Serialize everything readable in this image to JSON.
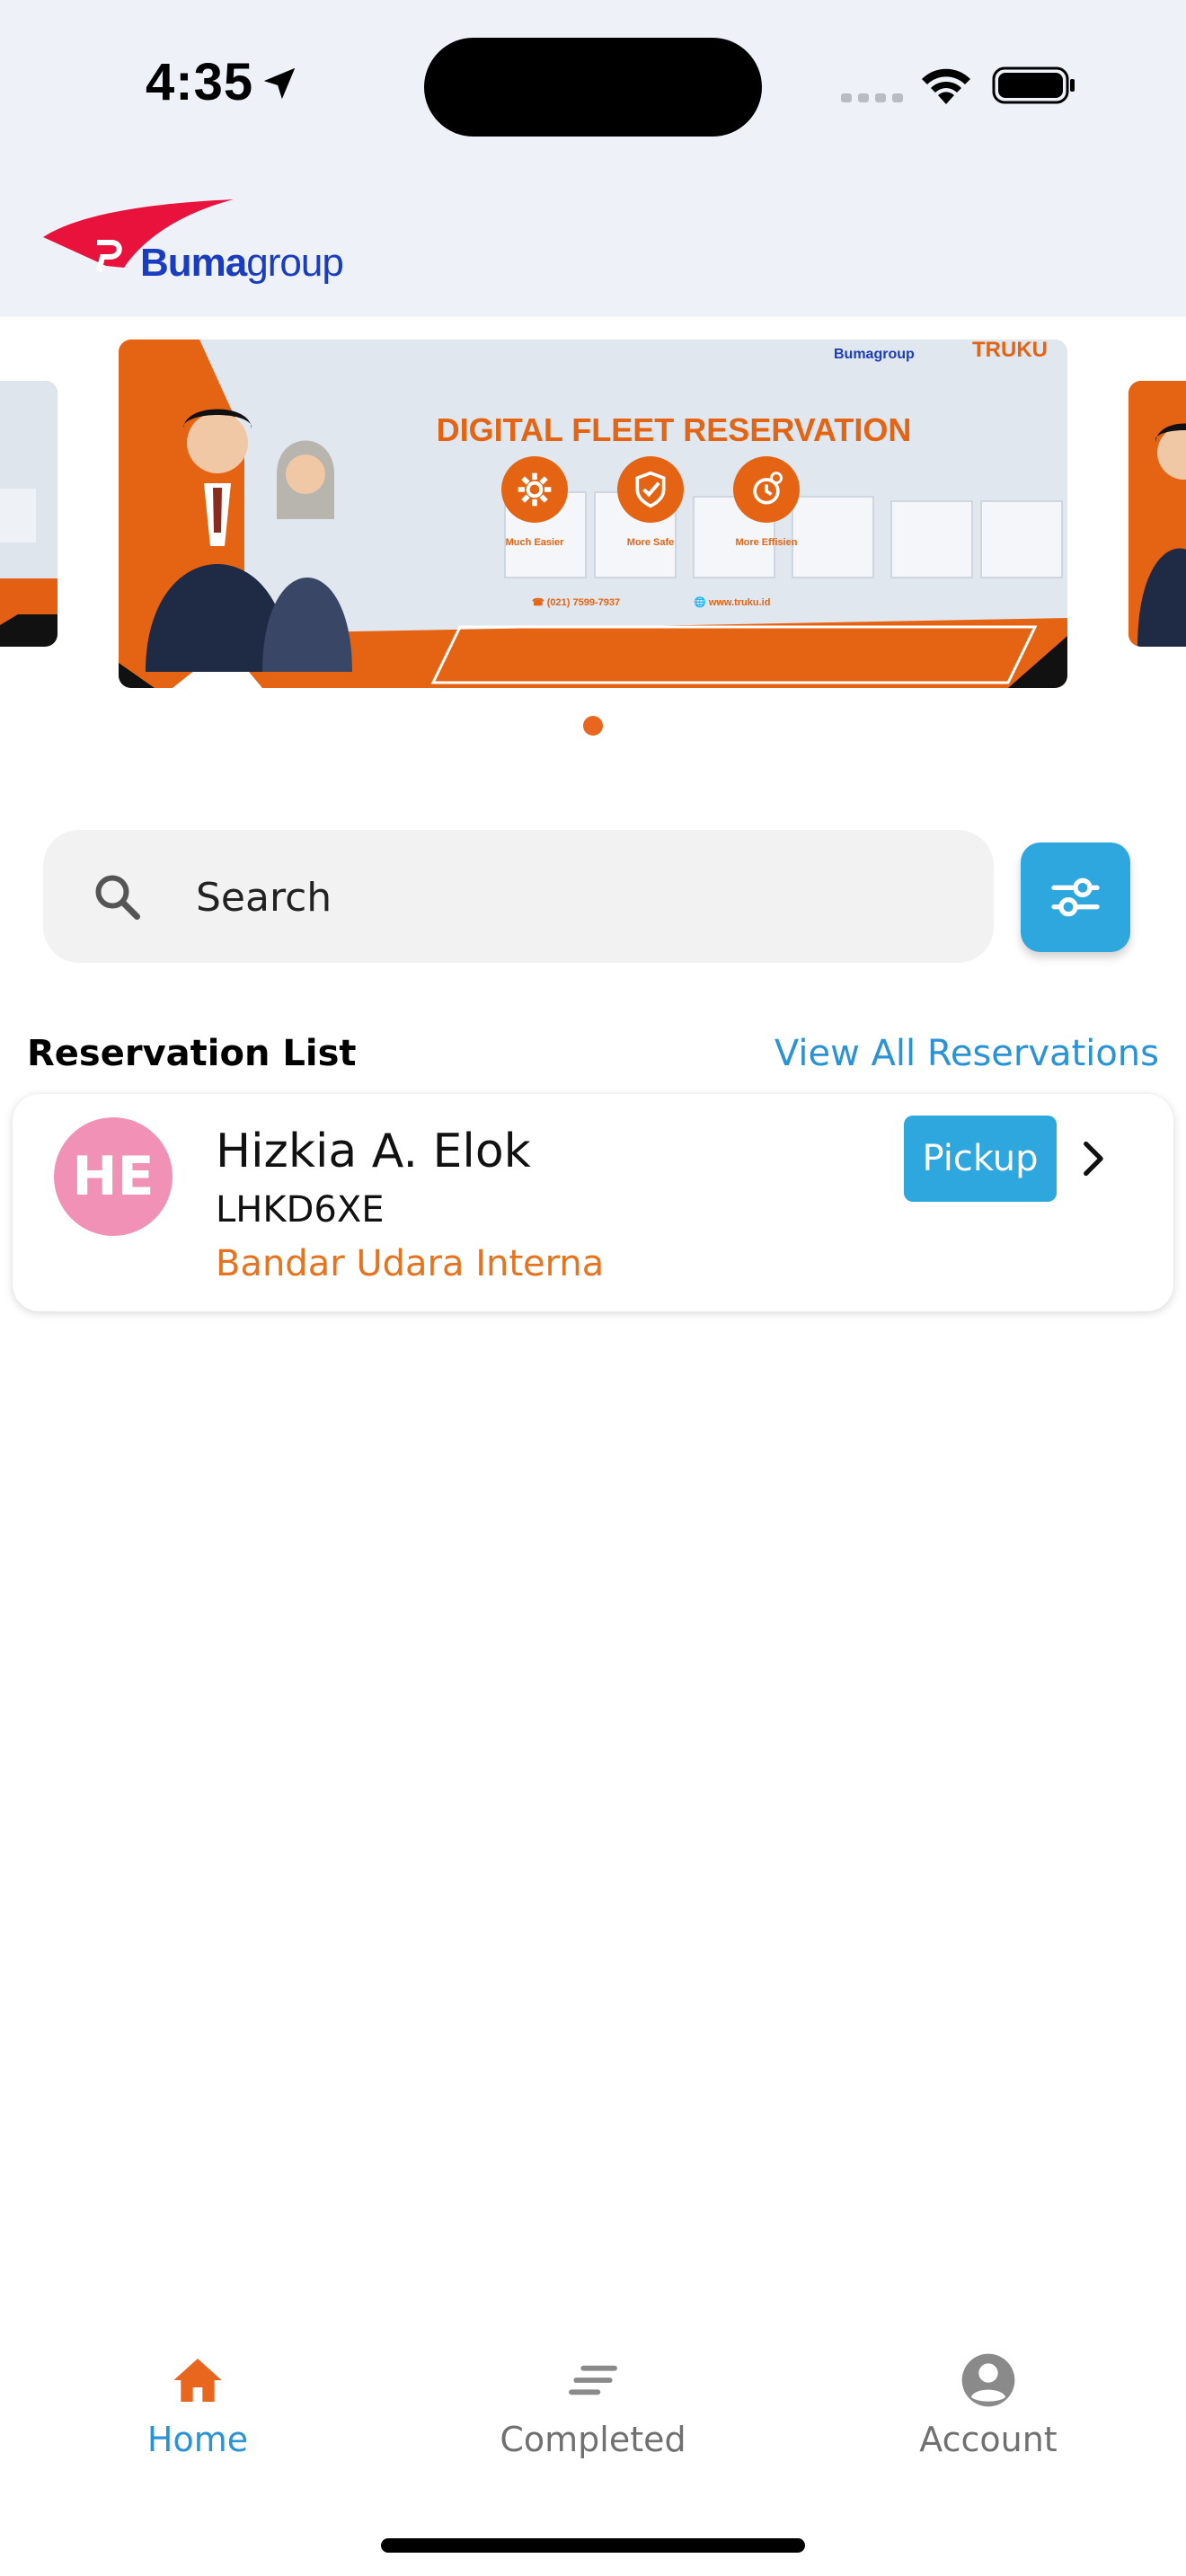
{
  "status_bar": {
    "time": "4:35"
  },
  "header": {
    "brand_bold": "Buma",
    "brand_light": "group"
  },
  "banner": {
    "title": "DIGITAL FLEET RESERVATION",
    "features": [
      "Much Easier",
      "More Safe",
      "More Effisien"
    ],
    "phone": "(021) 7599-7937",
    "website": "www.truku.id",
    "brand_left": "Bumagroup",
    "brand_right": "TRUKU"
  },
  "search": {
    "placeholder": "Search"
  },
  "reservations": {
    "title": "Reservation List",
    "view_all": "View All Reservations",
    "items": [
      {
        "initials": "HE",
        "name": "Hizkia A. Elok",
        "code": "LHKD6XE",
        "location": "Bandar Udara Interna",
        "status": "Pickup"
      }
    ]
  },
  "nav": {
    "items": [
      {
        "label": "Home",
        "active": true
      },
      {
        "label": "Completed",
        "active": false
      },
      {
        "label": "Account",
        "active": false
      }
    ]
  },
  "colors": {
    "accent": "#2ea6de",
    "brand_orange": "#e8661e",
    "avatar": "#f291b6",
    "link": "#2a93d5"
  }
}
